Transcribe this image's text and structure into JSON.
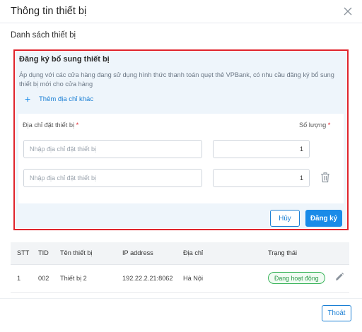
{
  "modal": {
    "title": "Thông tin thiết bị",
    "section_title": "Danh sách thiết bị"
  },
  "registration": {
    "title": "Đăng ký bổ sung thiết bị",
    "description": "Áp dụng với các cửa hàng đang sử dụng hình thức thanh toán quẹt thẻ VPBank, có nhu cầu đăng ký bổ sung thiết bị mới cho cửa hàng",
    "add_address_label": "Thêm địa chỉ khác",
    "address_label": "Địa chỉ đặt thiết bị",
    "quantity_label": "Số lượng",
    "required_mark": "*",
    "rows": [
      {
        "address_placeholder": "Nhập địa chỉ đặt thiết bị",
        "quantity": "1"
      },
      {
        "address_placeholder": "Nhập địa chỉ đặt thiết bị",
        "quantity": "1"
      }
    ],
    "cancel_label": "Hủy",
    "submit_label": "Đăng ký"
  },
  "table": {
    "headers": [
      "STT",
      "TID",
      "Tên thiết bị",
      "IP address",
      "Địa chỉ",
      "Trạng thái"
    ],
    "rows": [
      {
        "stt": "1",
        "tid": "002",
        "name": "Thiết bị 2",
        "ip": "192.22.2.21:8062",
        "address": "Hà Nội",
        "status": "Đang hoạt động"
      }
    ]
  },
  "footer": {
    "exit_label": "Thoát"
  },
  "colors": {
    "accent": "#1a8be8",
    "highlight": "#e0242c",
    "status_green": "#39b45a",
    "panel_bg": "#eef5fb"
  },
  "icons": [
    "close-icon",
    "plus-icon",
    "trash-icon",
    "edit-icon"
  ]
}
